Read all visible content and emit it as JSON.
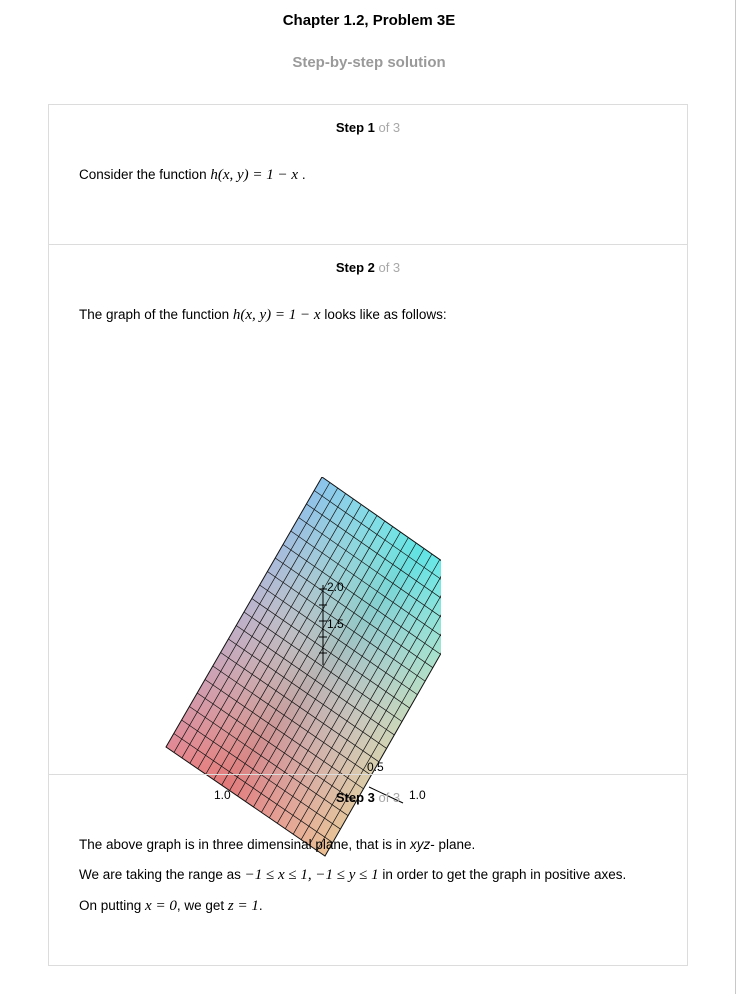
{
  "header": {
    "title": "Chapter 1.2, Problem 3E",
    "subtitle": "Step-by-step solution"
  },
  "steps": [
    {
      "label": "Step 1",
      "of": " of 3",
      "lines": [
        {
          "pre": "Consider the function ",
          "math": "h(x, y) = 1 − x",
          "post": "."
        }
      ]
    },
    {
      "label": "Step 2",
      "of": " of 3",
      "lines": [
        {
          "pre": "The graph of the function ",
          "math": "h(x, y) = 1 − x",
          "post": " looks like as follows:"
        }
      ],
      "graph": {
        "type": "3d-surface",
        "colormap": [
          "#ff4f4f",
          "#ffff3a",
          "#4b4bff",
          "#2bffff"
        ],
        "axis_labels": [
          "2.0",
          "1.5",
          "0.5",
          "1.0",
          "1.0"
        ]
      }
    },
    {
      "label": "Step 3",
      "of": " of 3",
      "lines": [
        {
          "pre": "The above graph is in three dimensinal plane, that is in ",
          "emph": "xyz",
          "post": "- plane."
        },
        {
          "pre": "We are taking the range as ",
          "math": "−1 ≤ x ≤ 1, −1 ≤ y ≤ 1",
          "post": " in order to get the graph in positive axes."
        },
        {
          "pre": "On putting ",
          "math": "x = 0",
          "mid": ", we get ",
          "math2": "z = 1",
          "post": "."
        }
      ]
    }
  ]
}
